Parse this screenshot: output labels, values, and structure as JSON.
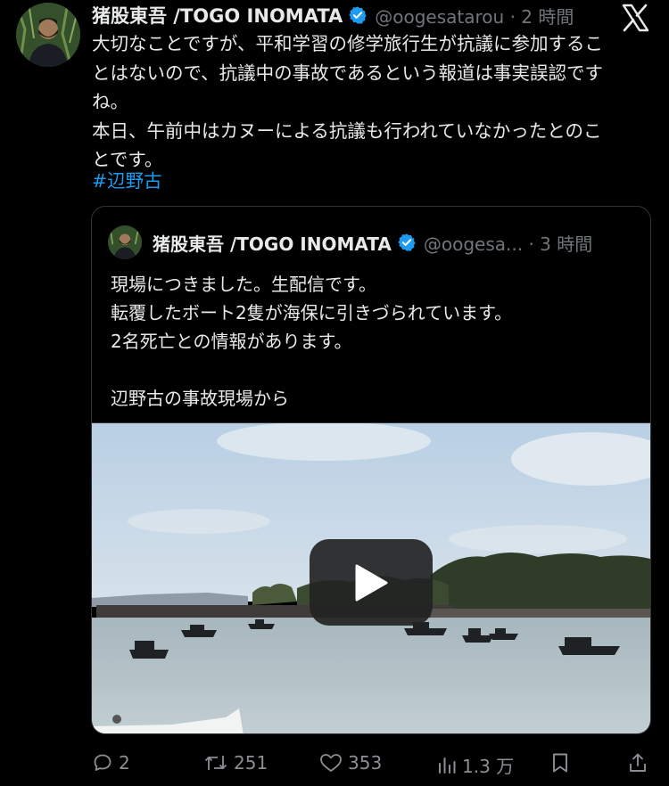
{
  "post": {
    "author_name": "猪股東吾 /TOGO INOMATA",
    "handle_time": "@oogesatarou · 2 時間",
    "text_lines": [
      "大切なことですが、平和学習の修学旅行生が抗議に参加するこ",
      "とはないので、抗議中の事故であるという報道は事実誤認です",
      "ね。",
      "本日、午前中はカヌーによる抗議も行われていなかったとのこ",
      "とです。"
    ],
    "hashtag": "#辺野古"
  },
  "quoted": {
    "author_name": "猪股東吾 /TOGO INOMATA",
    "handle_time": "@oogesa... · 3 時間",
    "text_lines": [
      "現場につきました。生配信です。",
      "転覆したボート2隻が海保に引きづられています。",
      "2名死亡との情報があります。",
      "",
      "辺野古の事故現場から"
    ]
  },
  "actions": {
    "reply_count": "2",
    "repost_count": "251",
    "like_count": "353",
    "view_count": "1.3 万"
  },
  "icons": {
    "verified": "verified-badge-icon",
    "platform": "x-logo-icon",
    "reply": "reply-icon",
    "repost": "repost-icon",
    "like": "heart-icon",
    "views": "views-icon",
    "bookmark": "bookmark-icon",
    "share": "share-icon",
    "play": "play-icon"
  },
  "colors": {
    "background": "#000000",
    "text": "#e7e9ea",
    "muted": "#71767b",
    "link": "#1d9bf0",
    "verified": "#1d9bf0"
  }
}
